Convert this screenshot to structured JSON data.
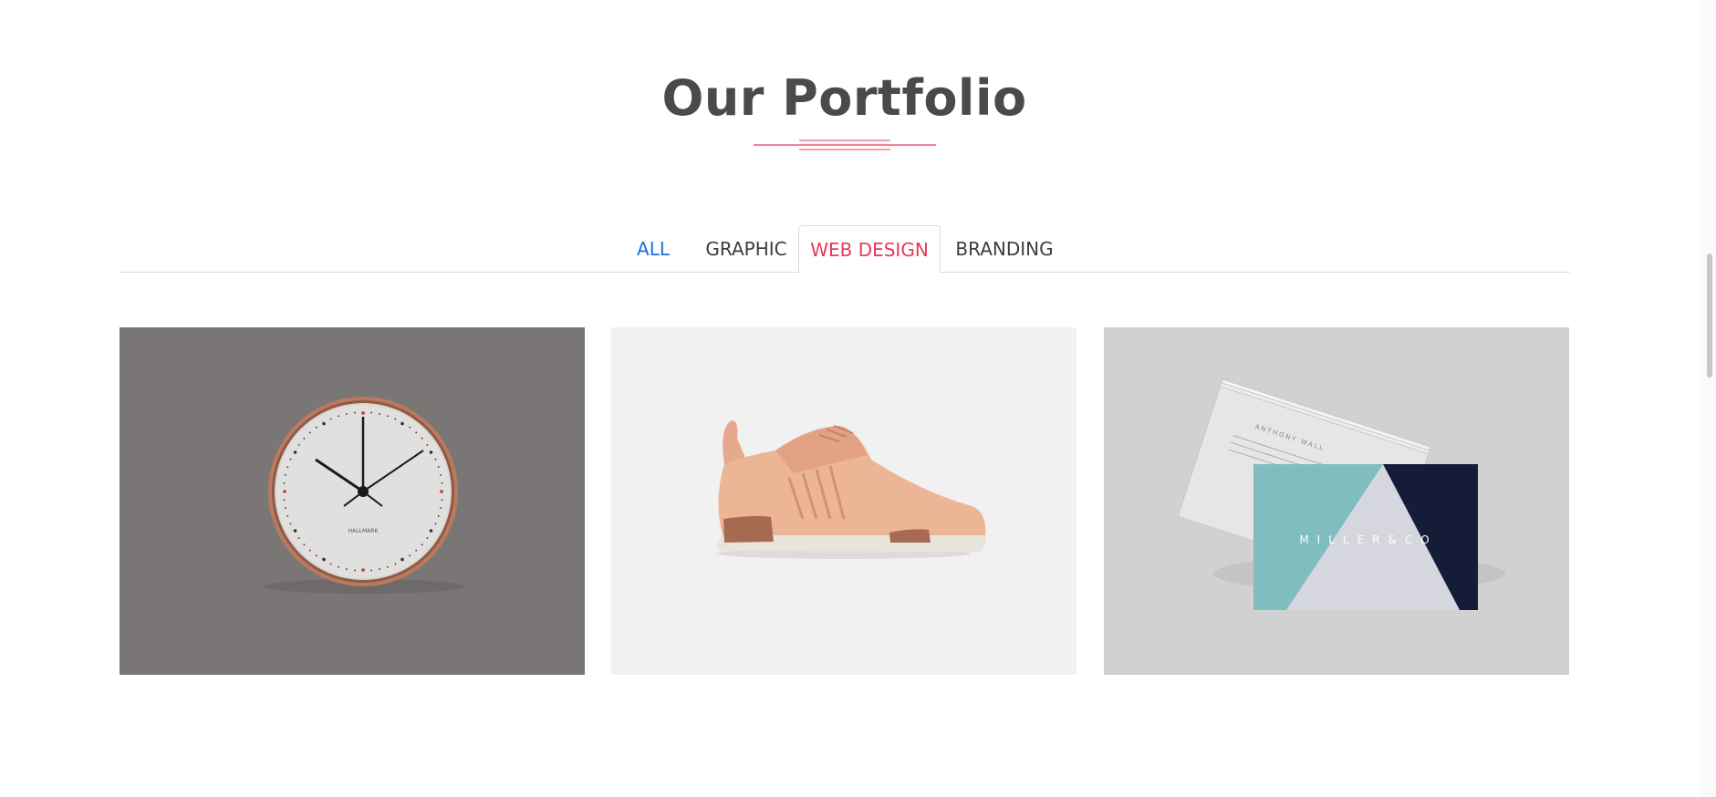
{
  "section": {
    "title": "Our Portfolio",
    "accent_color": "#e8395a"
  },
  "filters": {
    "tabs": [
      {
        "label": "ALL",
        "state": "link"
      },
      {
        "label": "GRAPHIC",
        "state": "default"
      },
      {
        "label": "WEB DESIGN",
        "state": "active"
      },
      {
        "label": "BRANDING",
        "state": "default"
      }
    ],
    "active_color": "#e8395a",
    "link_color": "#1e6fd9"
  },
  "portfolio": {
    "items": [
      {
        "subject": "wall-clock-image",
        "clock_text": "HALLMARK"
      },
      {
        "subject": "sneaker-image"
      },
      {
        "subject": "business-card-image",
        "card_brand": "MILLER&CO",
        "card_name": "ANTHONY WALL"
      }
    ]
  },
  "scrollbar": {
    "position": 0.4
  }
}
